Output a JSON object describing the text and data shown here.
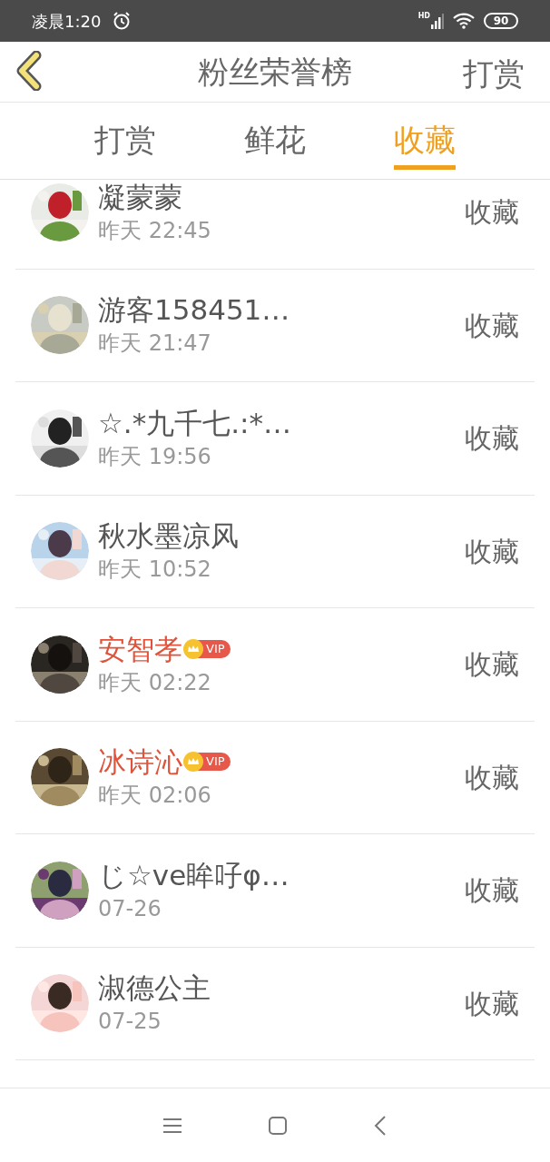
{
  "status_bar": {
    "time": "凌晨1:20",
    "network": "HD",
    "battery": "90"
  },
  "header": {
    "title": "粉丝荣誉榜",
    "action": "打赏"
  },
  "tabs": [
    {
      "label": "打赏",
      "selected": false
    },
    {
      "label": "鲜花",
      "selected": false
    },
    {
      "label": "收藏",
      "selected": true
    }
  ],
  "rows": [
    {
      "name": "凝蒙蒙",
      "time": "昨天 22:45",
      "action": "收藏",
      "vip": false
    },
    {
      "name": "游客158451…",
      "time": "昨天 21:47",
      "action": "收藏",
      "vip": false
    },
    {
      "name": "☆.*九千七.:*…",
      "time": "昨天 19:56",
      "action": "收藏",
      "vip": false
    },
    {
      "name": "秋水墨凉风",
      "time": "昨天 10:52",
      "action": "收藏",
      "vip": false
    },
    {
      "name": "安智孝",
      "time": "昨天 02:22",
      "action": "收藏",
      "vip": true,
      "badge": "VIP"
    },
    {
      "name": "冰诗沁",
      "time": "昨天 02:06",
      "action": "收藏",
      "vip": true,
      "badge": "VIP"
    },
    {
      "name": "じ☆ve眸吇φ…",
      "time": "07-26",
      "action": "收藏",
      "vip": false
    },
    {
      "name": "淑德公主",
      "time": "07-25",
      "action": "收藏",
      "vip": false
    }
  ]
}
